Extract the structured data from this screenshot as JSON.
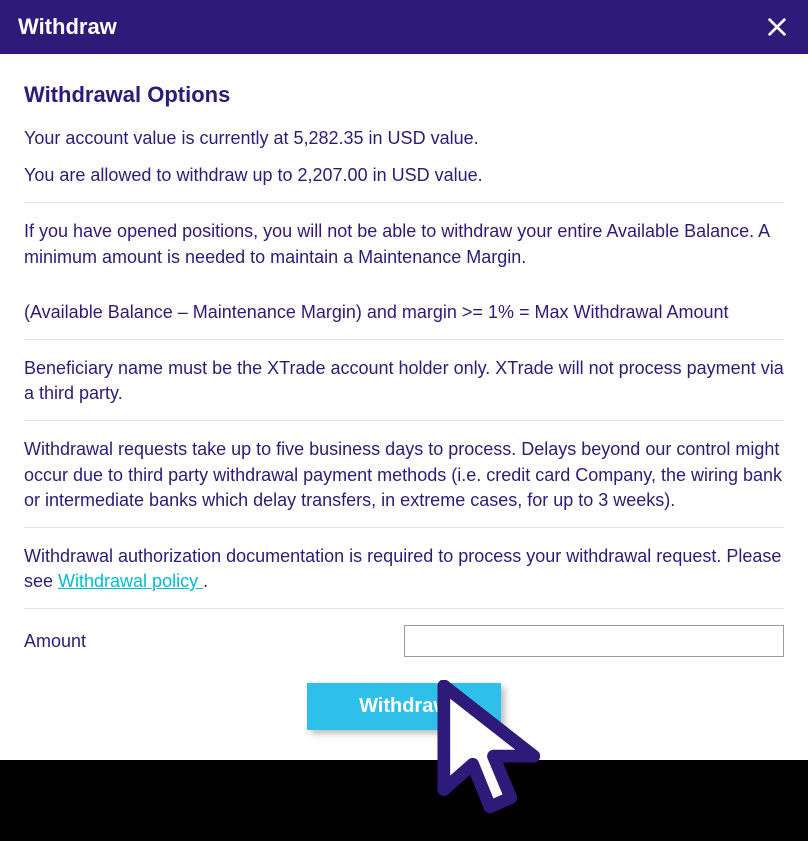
{
  "header": {
    "title": "Withdraw"
  },
  "options": {
    "heading": "Withdrawal Options",
    "account_value_line": "Your account value is currently at 5,282.35 in USD value.",
    "withdraw_limit_line": "You are allowed to withdraw up to 2,207.00 in USD value.",
    "positions_note": "If you have opened positions, you will not be able to withdraw your entire Available Balance. A minimum amount is needed to maintain a Maintenance Margin.",
    "formula_line": "(Available Balance – Maintenance Margin) and margin >= 1% = Max Withdrawal Amount",
    "beneficiary_note": "Beneficiary name must be the XTrade account holder only. XTrade will not process payment via a third party.",
    "processing_note": "Withdrawal requests take up to five business days to process. Delays beyond our control might occur due to third party withdrawal payment methods (i.e. credit card Company, the wiring bank or intermediate banks which delay transfers, in extreme cases, for up to 3 weeks).",
    "auth_note_prefix": "Withdrawal authorization documentation is required to process your withdrawal request. Please see ",
    "policy_link_label": "Withdrawal policy ",
    "auth_note_suffix": "."
  },
  "form": {
    "amount_label": "Amount",
    "amount_value": "",
    "submit_label": "Withdraw"
  }
}
